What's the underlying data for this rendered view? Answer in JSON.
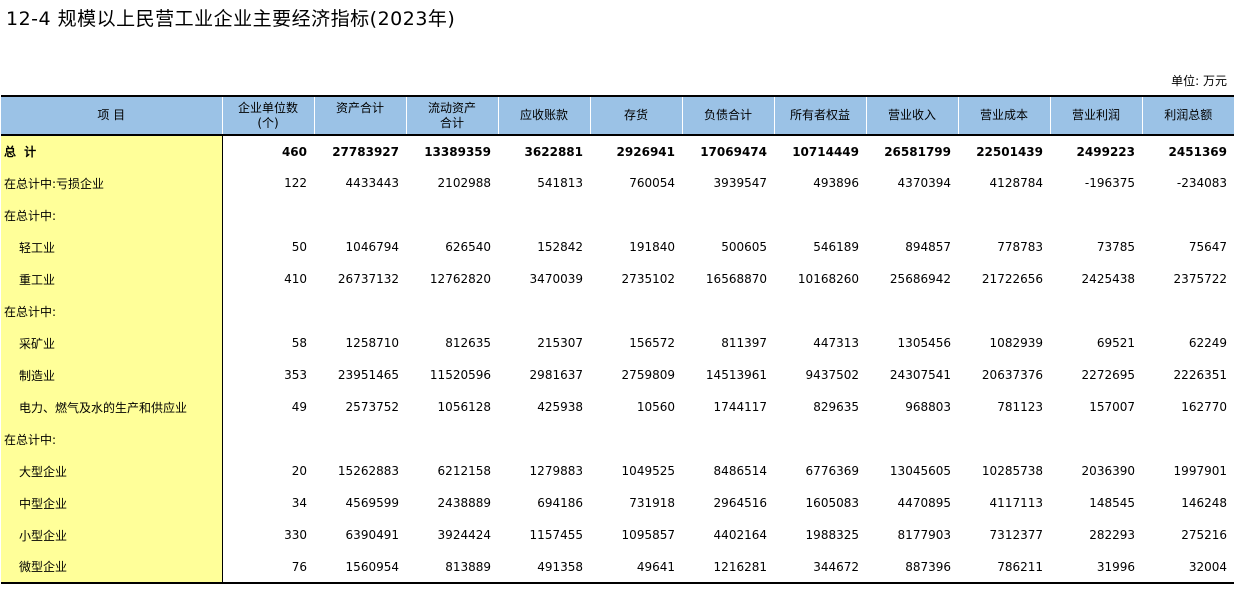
{
  "title": "12-4 规模以上民营工业企业主要经济指标(2023年)",
  "unit": "单位: 万元",
  "columns": [
    {
      "line1": "项 目",
      "line2": ""
    },
    {
      "line1": "企业单位数",
      "line2": "(个)"
    },
    {
      "line1": "资产合计",
      "line2": ""
    },
    {
      "line1": "流动资产",
      "line2": "合计"
    },
    {
      "line1": "应收账款",
      "line2": ""
    },
    {
      "line1": "存货",
      "line2": ""
    },
    {
      "line1": "负债合计",
      "line2": ""
    },
    {
      "line1": "所有者权益",
      "line2": ""
    },
    {
      "line1": "营业收入",
      "line2": ""
    },
    {
      "line1": "营业成本",
      "line2": ""
    },
    {
      "line1": "营业利润",
      "line2": ""
    },
    {
      "line1": "利润总额",
      "line2": ""
    }
  ],
  "rows": [
    {
      "label": "总 计",
      "values": [
        "460",
        "27783927",
        "13389359",
        "3622881",
        "2926941",
        "17069474",
        "10714449",
        "26581799",
        "22501439",
        "2499223",
        "2451369"
      ]
    },
    {
      "label": "在总计中:亏损企业",
      "values": [
        "122",
        "4433443",
        "2102988",
        "541813",
        "760054",
        "3939547",
        "493896",
        "4370394",
        "4128784",
        "-196375",
        "-234083"
      ]
    },
    {
      "label": "在总计中:",
      "values": [
        "",
        "",
        "",
        "",
        "",
        "",
        "",
        "",
        "",
        "",
        ""
      ]
    },
    {
      "label": "轻工业",
      "values": [
        "50",
        "1046794",
        "626540",
        "152842",
        "191840",
        "500605",
        "546189",
        "894857",
        "778783",
        "73785",
        "75647"
      ]
    },
    {
      "label": "重工业",
      "values": [
        "410",
        "26737132",
        "12762820",
        "3470039",
        "2735102",
        "16568870",
        "10168260",
        "25686942",
        "21722656",
        "2425438",
        "2375722"
      ]
    },
    {
      "label": "在总计中:",
      "values": [
        "",
        "",
        "",
        "",
        "",
        "",
        "",
        "",
        "",
        "",
        ""
      ]
    },
    {
      "label": "采矿业",
      "values": [
        "58",
        "1258710",
        "812635",
        "215307",
        "156572",
        "811397",
        "447313",
        "1305456",
        "1082939",
        "69521",
        "62249"
      ]
    },
    {
      "label": "制造业",
      "values": [
        "353",
        "23951465",
        "11520596",
        "2981637",
        "2759809",
        "14513961",
        "9437502",
        "24307541",
        "20637376",
        "2272695",
        "2226351"
      ]
    },
    {
      "label": "电力、燃气及水的生产和供应业",
      "values": [
        "49",
        "2573752",
        "1056128",
        "425938",
        "10560",
        "1744117",
        "829635",
        "968803",
        "781123",
        "157007",
        "162770"
      ]
    },
    {
      "label": "在总计中:",
      "values": [
        "",
        "",
        "",
        "",
        "",
        "",
        "",
        "",
        "",
        "",
        ""
      ]
    },
    {
      "label": "大型企业",
      "values": [
        "20",
        "15262883",
        "6212158",
        "1279883",
        "1049525",
        "8486514",
        "6776369",
        "13045605",
        "10285738",
        "2036390",
        "1997901"
      ]
    },
    {
      "label": "中型企业",
      "values": [
        "34",
        "4569599",
        "2438889",
        "694186",
        "731918",
        "2964516",
        "1605083",
        "4470895",
        "4117113",
        "148545",
        "146248"
      ]
    },
    {
      "label": "小型企业",
      "values": [
        "330",
        "6390491",
        "3924424",
        "1157455",
        "1095857",
        "4402164",
        "1988325",
        "8177903",
        "7312377",
        "282293",
        "275216"
      ]
    },
    {
      "label": "微型企业",
      "values": [
        "76",
        "1560954",
        "813889",
        "491358",
        "49641",
        "1216281",
        "344672",
        "887396",
        "786211",
        "31996",
        "32004"
      ]
    }
  ]
}
